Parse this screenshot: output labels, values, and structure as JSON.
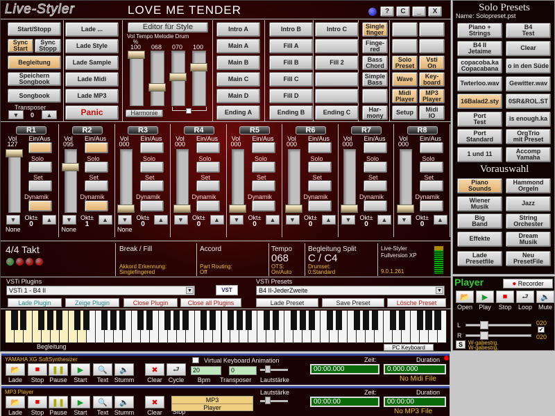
{
  "app": {
    "logo": "Live-Styler",
    "song_title": "LOVE ME TENDER",
    "window_buttons": [
      "?",
      "C",
      "_",
      "X"
    ]
  },
  "left_col1": [
    "Start/Stopp",
    "Sync\nStart",
    "Sync\nStopp",
    "Begleitung",
    "Speichern\nSongbook",
    "Songbook"
  ],
  "transposer": {
    "label": "Transposer",
    "value": "0"
  },
  "left_col2": [
    "Lade ...",
    "Lade Style",
    "Lade Sample",
    "Lade Midi",
    "Lade MP3",
    "Panic"
  ],
  "editor": {
    "button": "Editor für Style",
    "headers": "Vol Tempo Melodie Drum",
    "percent": "%",
    "sliders": [
      {
        "value": "100",
        "level": 1.0
      },
      {
        "value": "068",
        "level": 0.35
      },
      {
        "value": "070",
        "level": 0.55
      },
      {
        "value": "100",
        "level": 0.75
      }
    ],
    "harmonie": "Harmonie"
  },
  "section_cols": [
    [
      "Intro A",
      "Main A",
      "Main B",
      "Main C",
      "Main D",
      "Ending A"
    ],
    [
      "Intro B",
      "Fill A",
      "Fill B",
      "Fill C",
      "Fill D",
      "Ending B"
    ],
    [
      "Intro C",
      "",
      "Fill 2",
      "",
      "",
      "Ending C"
    ],
    [
      "Single\nfinger",
      "Finge-\nred",
      "Bass\nChord",
      "Simple\nBass",
      "",
      "Har-\nmony"
    ]
  ],
  "mode_grid": [
    "",
    "",
    "",
    "",
    "Solo\nPreset",
    "Vsti\nOn",
    "Wave",
    "Key-\nboard",
    "Midi\nPlayer",
    "MP3\nPlayer",
    "Setup",
    "Midi\nIO"
  ],
  "mode_grid_on": [
    false,
    false,
    false,
    false,
    true,
    true,
    true,
    true,
    true,
    true,
    false,
    false
  ],
  "section_on": {
    "col3_0": true
  },
  "channels": [
    {
      "name": "R1",
      "vol": "127",
      "level": 1.0,
      "okt": "0",
      "none": "None",
      "ein": true,
      "dyn": true
    },
    {
      "name": "R2",
      "vol": "095",
      "level": 0.75,
      "okt": "1",
      "none": "None",
      "ein": true,
      "dyn": true
    },
    {
      "name": "R3",
      "vol": "000",
      "level": 0,
      "okt": "0",
      "none": "None",
      "ein": false,
      "dyn": false
    },
    {
      "name": "R4",
      "vol": "000",
      "level": 0,
      "okt": "0",
      "none": "",
      "ein": false,
      "dyn": false
    },
    {
      "name": "R5",
      "vol": "000",
      "level": 0,
      "okt": "0",
      "none": "",
      "ein": false,
      "dyn": false
    },
    {
      "name": "R6",
      "vol": "000",
      "level": 0,
      "okt": "0",
      "none": "",
      "ein": false,
      "dyn": false
    },
    {
      "name": "R7",
      "vol": "000",
      "level": 0,
      "okt": "0",
      "none": "",
      "ein": false,
      "dyn": false
    },
    {
      "name": "R8",
      "vol": "000",
      "level": 0,
      "okt": "0",
      "none": "",
      "ein": false,
      "dyn": false
    }
  ],
  "channel_labels": {
    "vol": "Vol",
    "ein": "Ein/Aus",
    "solo": "Solo",
    "set": "Set",
    "dyn": "Dynamik",
    "okt": "Okt±"
  },
  "status": {
    "takt": "4/4 Takt",
    "break_fill": "Break / Fill",
    "akkord_label": "Akkord Erkennung:",
    "akkord_value": "Singlefingered",
    "accord": "Accord",
    "routing_label": "Part Routing:",
    "routing_value": "Off",
    "tempo_label": "Tempo",
    "tempo": "068",
    "ots_label": "OTS:",
    "ots_value": "On/Auto",
    "split_label": "Begleitung Split",
    "split": "C / C4",
    "drumset_label": "Drumset:",
    "drumset_value": "0:Standard",
    "ls_name": "Live-Styler",
    "ls_edition": "Fullversion XP",
    "ls_version": "9.0.1.261"
  },
  "vsti": {
    "plugins_label": "VSTi Plugins",
    "plugin_selected": "VSTi 1 - B4 II",
    "logo": "VST",
    "presets_label": "VSTi Presets",
    "preset_selected": "B4 II-JederZweite",
    "buttons": [
      "Lade Plugin",
      "Zeige Plugin",
      "Close Plugin",
      "Close all Plugins",
      "Lade Preset",
      "Save Preset",
      "Lösche Preset"
    ]
  },
  "keyboard": {
    "begleitung": "Begleitung",
    "pc_keyboard": "PC Keyboard"
  },
  "solo_presets": {
    "title": "Solo Presets",
    "name": "Name: Solopreset.pst",
    "items": [
      "Piano +\nStrings",
      "B4\nTest",
      "B4 II\nJetaime",
      "Clear",
      "copacoba.ka\nCopacabana",
      "o in den Süde",
      "Twterloo.wav",
      "Gewitter.wav",
      "16Balad2.sty",
      "0SR&ROL.ST",
      "Port\nTest",
      "is enough.ka",
      "Port\nStandard",
      "OrgTrio\nmit Preset",
      "1 und 11",
      "Accomp\nYamaha"
    ],
    "items_on": [
      8
    ]
  },
  "vorauswahl": {
    "title": "Vorauswahl",
    "items": [
      "Piano\nSounds",
      "Hammond\nOrgeln",
      "Wiener\nMusik",
      "Jazz",
      "Big\nBand",
      "String\nOrchester",
      "Effekte",
      "Dream\nMusik",
      "Lade\nPresetfile",
      "Neu\nPresetFile"
    ],
    "items_on": [
      0
    ]
  },
  "player": {
    "title": "Player",
    "recorder": "Recorder",
    "controls": [
      "Open",
      "Play",
      "Stop",
      "Loop",
      "Mute"
    ],
    "l": "L",
    "r": "R",
    "l_value": "020",
    "r_value": "020",
    "balance_level": 0.25,
    "s": "S",
    "wgabe1": "W-gabestrg.",
    "wgabe2": "W-gabestrg."
  },
  "midi_bar": {
    "title": "YAMAHA XG SoftSynthesizer",
    "controls": [
      "Lade",
      "Stop",
      "Pause",
      "Start",
      "Text",
      "Stumm",
      "Clear",
      "Cycle"
    ],
    "vk_anim": "Virtual Keyboard Animation",
    "bpm": "20",
    "bpm_label": "Bpm",
    "transposer": "0",
    "transposer_label": "Transposer",
    "volume_label": "Lautstärke",
    "zeit_label": "Zeit:",
    "duration_label": "Duration",
    "zeit": "00:00.000",
    "duration": "0.000.000",
    "file": "No Midi File"
  },
  "mp3_bar": {
    "title": "MP3 Player",
    "controls": [
      "Lade",
      "Stop",
      "Pause",
      "Start",
      "Text",
      "Stumm",
      "Clear",
      "Stop"
    ],
    "mp3_line1": "MP3",
    "mp3_line2": "Player",
    "volume_label": "Lautstärke",
    "zeit_label": "Zeit:",
    "duration_label": "Duration",
    "zeit": "00:00:00",
    "duration": "00:00:00",
    "file": "No MP3 File"
  },
  "colors": {
    "accent_on": "#e8c080",
    "status_text": "#e8c020",
    "player_title": "#30d030",
    "time_box": "#0a6a0a"
  }
}
